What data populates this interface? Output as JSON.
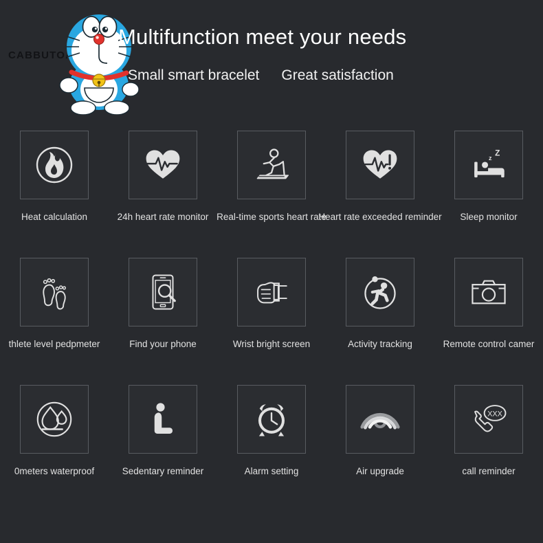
{
  "theme": {
    "background": "#282a2e",
    "icon_box_bg": "#2b2d31",
    "icon_box_border": "#595c61",
    "icon_stroke": "#e0e0e0",
    "label_color": "#e2e2e2",
    "headline_color": "#ffffff",
    "brand_color": "#121316",
    "mascot_blue": "#29a7e1",
    "mascot_red": "#e1322c",
    "mascot_yellow": "#f2c317"
  },
  "header": {
    "brand": "CABBUTOA",
    "mascot_icon": "doraemon-mascot",
    "headline": "Multifunction meet your needs",
    "subline_left": "Small smart bracelet",
    "subline_right": "Great satisfaction"
  },
  "grid": {
    "columns": 5,
    "rows": 3,
    "cells": [
      {
        "icon": "flame-circle-icon",
        "label": "Heat calculation"
      },
      {
        "icon": "heart-pulse-icon",
        "label": "24h heart rate monitor"
      },
      {
        "icon": "treadmill-runner-icon",
        "label": "Real-time sports heart rate"
      },
      {
        "icon": "heart-alert-icon",
        "label": "Heart rate exceeded reminder"
      },
      {
        "icon": "bed-sleep-icon",
        "label": "Sleep monitor"
      },
      {
        "icon": "footprints-icon",
        "label": "thlete level pedpmeter"
      },
      {
        "icon": "phone-search-icon",
        "label": "Find your phone"
      },
      {
        "icon": "wrist-fist-icon",
        "label": "Wrist bright screen"
      },
      {
        "icon": "runner-circle-icon",
        "label": "Activity tracking"
      },
      {
        "icon": "camera-icon",
        "label": "Remote control camer"
      },
      {
        "icon": "waterdrop-circle-icon",
        "label": "0meters waterproof"
      },
      {
        "icon": "sitting-person-icon",
        "label": "Sedentary reminder"
      },
      {
        "icon": "alarm-clock-icon",
        "label": "Alarm setting"
      },
      {
        "icon": "wireless-waves-icon",
        "label": "Air upgrade"
      },
      {
        "icon": "phone-call-xxx-icon",
        "label": "call reminder"
      }
    ]
  }
}
